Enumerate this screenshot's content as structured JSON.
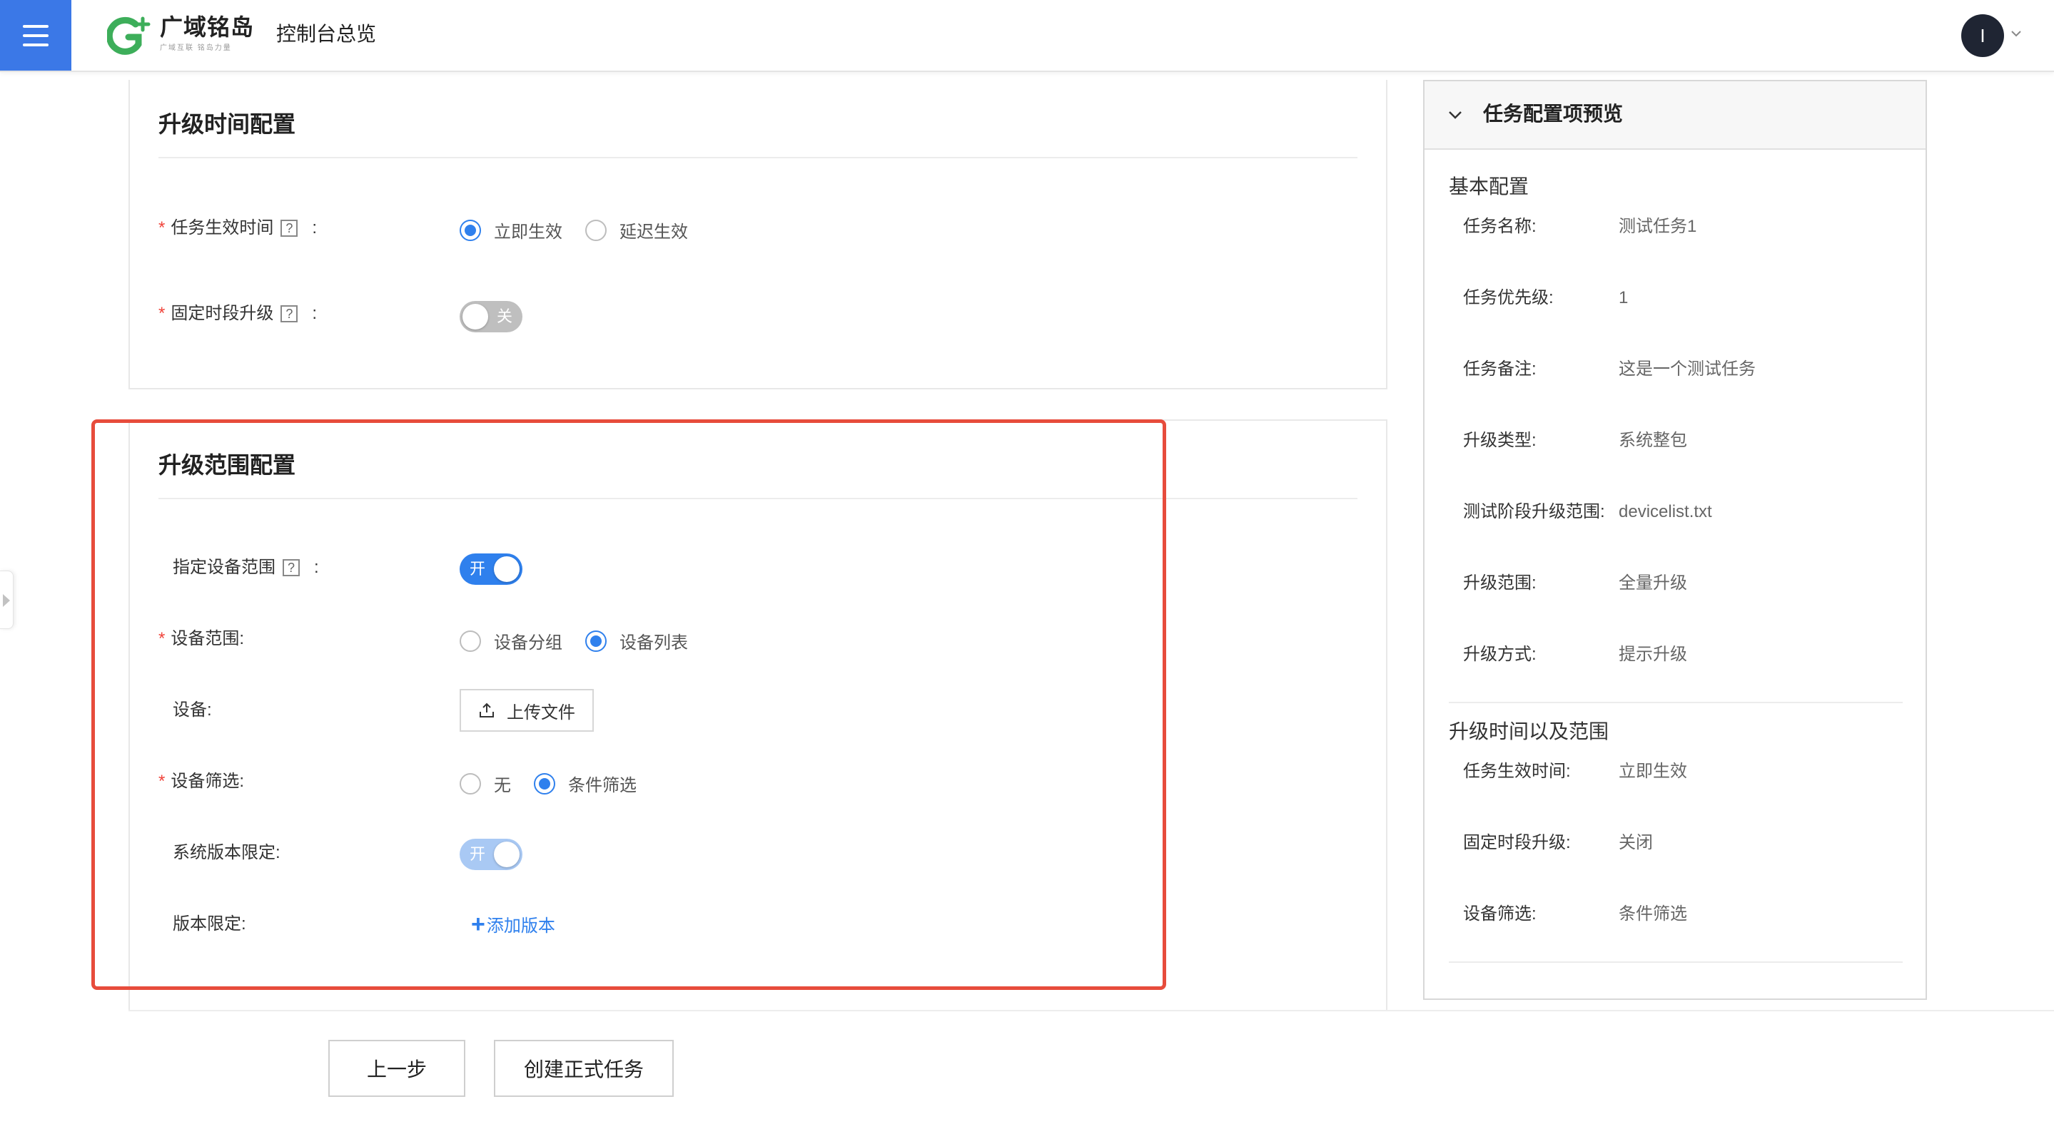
{
  "header": {
    "brand_name": "广域铭岛",
    "brand_tagline": "广域互联 铭岛力量",
    "console_title": "控制台总览",
    "user_initial": "I"
  },
  "time_config": {
    "title": "升级时间配置",
    "effective_time": {
      "label": "任务生效时间",
      "options": [
        "立即生效",
        "延迟生效"
      ],
      "selected": "立即生效"
    },
    "fixed_period": {
      "label": "固定时段升级",
      "switch_text": "关",
      "on": false
    }
  },
  "range_config": {
    "title": "升级范围配置",
    "specify_range": {
      "label": "指定设备范围",
      "switch_text": "开",
      "on": true
    },
    "device_range": {
      "label": "设备范围:",
      "options": [
        "设备分组",
        "设备列表"
      ],
      "selected": "设备列表"
    },
    "device": {
      "label": "设备:",
      "upload_label": "上传文件"
    },
    "device_filter": {
      "label": "设备筛选:",
      "options": [
        "无",
        "条件筛选"
      ],
      "selected": "条件筛选"
    },
    "version_limit_switch": {
      "label": "系统版本限定:",
      "switch_text": "开",
      "on": true
    },
    "version_limit": {
      "label": "版本限定:",
      "add_label": "添加版本"
    }
  },
  "footer": {
    "prev_label": "上一步",
    "create_label": "创建正式任务"
  },
  "preview": {
    "title": "任务配置项预览",
    "basic": {
      "title": "基本配置",
      "items": [
        {
          "label": "任务名称:",
          "value": "测试任务1"
        },
        {
          "label": "任务优先级:",
          "value": "1"
        },
        {
          "label": "任务备注:",
          "value": "这是一个测试任务"
        },
        {
          "label": "升级类型:",
          "value": "系统整包"
        },
        {
          "label": "测试阶段升级范围:",
          "value": "devicelist.txt"
        },
        {
          "label": "升级范围:",
          "value": "全量升级"
        },
        {
          "label": "升级方式:",
          "value": "提示升级"
        }
      ]
    },
    "time_range": {
      "title": "升级时间以及范围",
      "items": [
        {
          "label": "任务生效时间:",
          "value": "立即生效"
        },
        {
          "label": "固定时段升级:",
          "value": "关闭"
        },
        {
          "label": "设备筛选:",
          "value": "条件筛选"
        }
      ]
    }
  },
  "colors": {
    "primary": "#2f80ed",
    "menu_bg": "#3b78e7",
    "required": "#f0433a",
    "highlight": "#e74c3c",
    "brand_green": "#3dae5a"
  }
}
